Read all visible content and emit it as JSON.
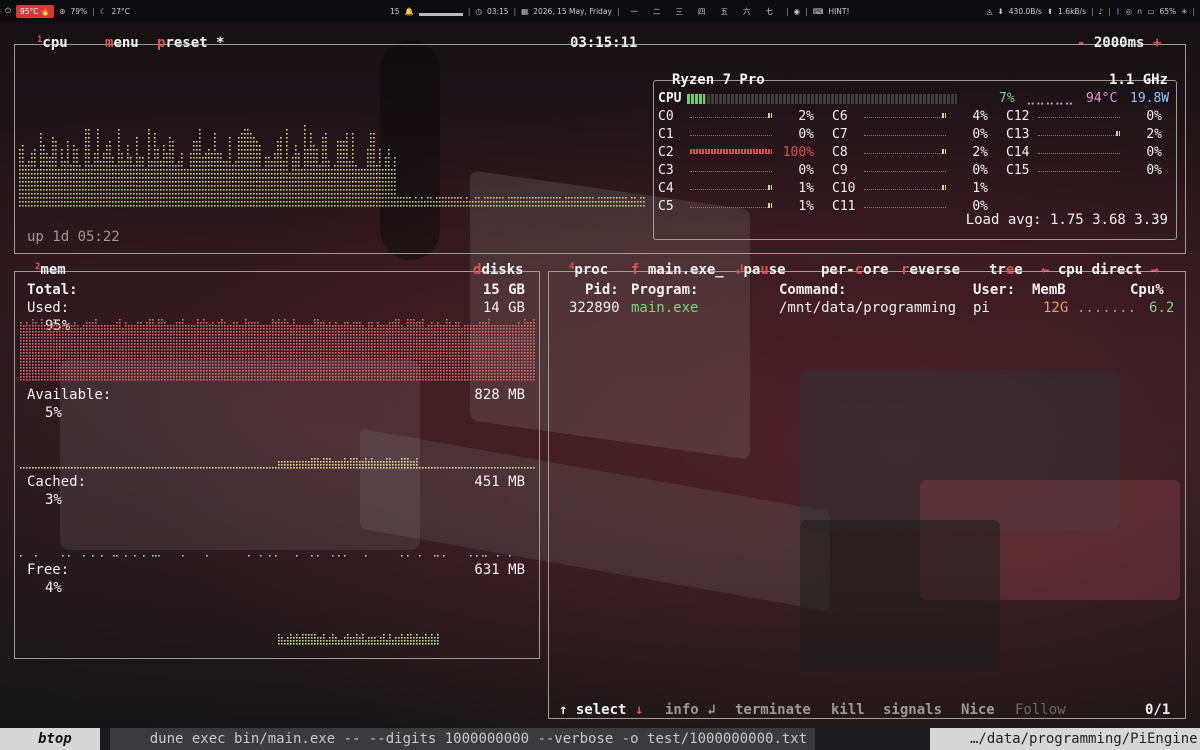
{
  "topbar": {
    "cpu_temp": "95°C",
    "brightness": "79%",
    "weather_temp": "27°C",
    "notifications": "15",
    "time": "03:15",
    "date": "2026, 15 May, Friday",
    "workspaces": [
      "一",
      "二",
      "三",
      "四",
      "五",
      "六",
      "七"
    ],
    "hint": "HINT!",
    "net_down": "430.0B/s",
    "net_up": "1.6kB/s",
    "battery": "65%"
  },
  "cpu": {
    "title": "cpu",
    "title_num": "1",
    "menu": "menu",
    "preset": "preset *",
    "clock": "03:15:11",
    "interval": "2000ms",
    "uptime": "up 1d 05:22",
    "model": "Ryzen 7 Pro",
    "freq": "1.1 GHz",
    "total_label": "CPU",
    "total_pct": "7%",
    "temp": "94°C",
    "power": "19.8W",
    "cores_col1": [
      {
        "name": "C0",
        "pct": "2%",
        "value": 2
      },
      {
        "name": "C1",
        "pct": "0%",
        "value": 0
      },
      {
        "name": "C2",
        "pct": "100%",
        "value": 100
      },
      {
        "name": "C3",
        "pct": "0%",
        "value": 0
      },
      {
        "name": "C4",
        "pct": "1%",
        "value": 1
      },
      {
        "name": "C5",
        "pct": "1%",
        "value": 1
      }
    ],
    "cores_col2": [
      {
        "name": "C6",
        "pct": "4%",
        "value": 4
      },
      {
        "name": "C7",
        "pct": "0%",
        "value": 0
      },
      {
        "name": "C8",
        "pct": "2%",
        "value": 2
      },
      {
        "name": "C9",
        "pct": "0%",
        "value": 0
      },
      {
        "name": "C10",
        "pct": "1%",
        "value": 1
      },
      {
        "name": "C11",
        "pct": "0%",
        "value": 0
      }
    ],
    "cores_col3": [
      {
        "name": "C12",
        "pct": "0%",
        "value": 0
      },
      {
        "name": "C13",
        "pct": "2%",
        "value": 2
      },
      {
        "name": "C14",
        "pct": "0%",
        "value": 0
      },
      {
        "name": "C15",
        "pct": "0%",
        "value": 0
      }
    ],
    "load_label": "Load avg:",
    "load": "1.75 3.68 3.39"
  },
  "mem": {
    "title": "mem",
    "title_num": "2",
    "disks": "disks",
    "total_label": "Total:",
    "total": "15 GB",
    "used_label": "Used:",
    "used": "14 GB",
    "used_pct": "95%",
    "avail_label": "Available:",
    "avail": "828 MB",
    "avail_pct": "5%",
    "cached_label": "Cached:",
    "cached": "451 MB",
    "cached_pct": "3%",
    "free_label": "Free:",
    "free": "631 MB",
    "free_pct": "4%"
  },
  "proc": {
    "title": "proc",
    "title_num": "4",
    "filter_key": "f",
    "filter": "main.exe_",
    "pause": "pause",
    "per_core": "per-core",
    "reverse": "reverse",
    "tree": "tree",
    "sort": "cpu direct",
    "headers": {
      "pid": "Pid:",
      "program": "Program:",
      "command": "Command:",
      "user": "User:",
      "mem": "MemB",
      "cpu": "Cpu%"
    },
    "rows": [
      {
        "pid": "322890",
        "program": "main.exe",
        "command": "/mnt/data/programming",
        "user": "pi",
        "mem": "12G",
        "cpu": "6.2"
      }
    ],
    "footer": {
      "select": "select",
      "info": "info",
      "terminate": "terminate",
      "kill": "kill",
      "signals": "signals",
      "nice": "Nice",
      "follow": "Follow",
      "count": "0/1"
    }
  },
  "bottombar": {
    "tab": "btop",
    "command": "dune exec bin/main.exe -- --digits 1000000000 --verbose -o test/1000000000.txt",
    "cwd": "…/data/programming/PiEngine"
  }
}
